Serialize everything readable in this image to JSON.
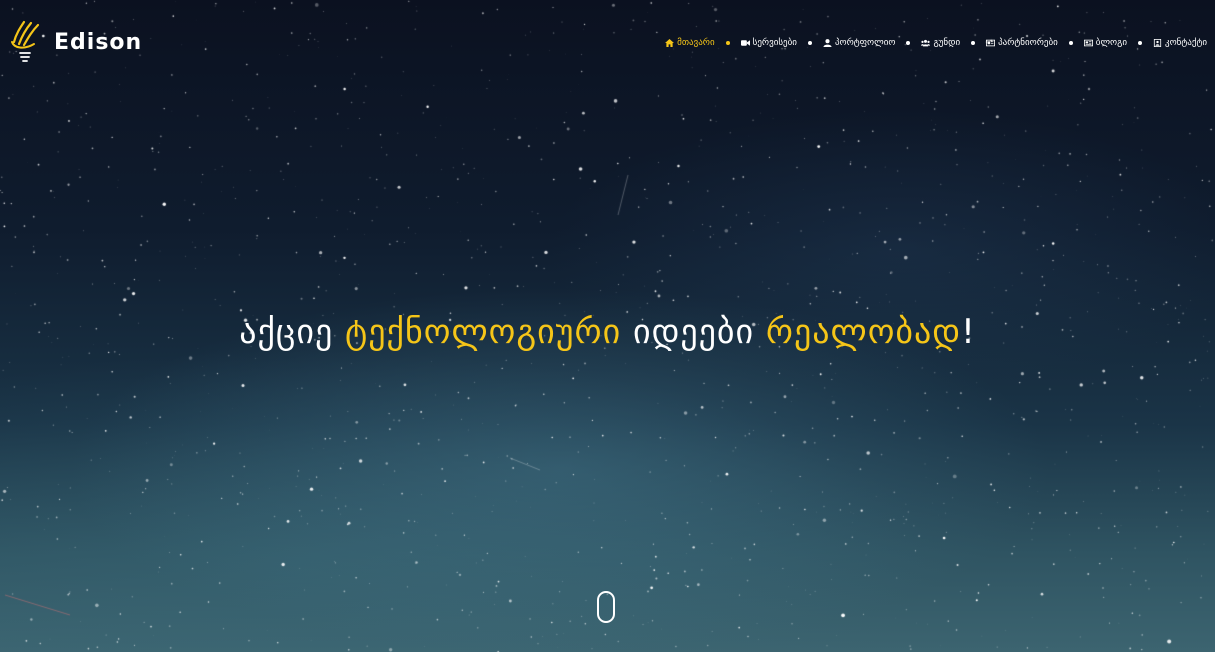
{
  "brand": {
    "name": "Edison",
    "accent_color": "#f5c518",
    "logo_icon": "lightbulb-slash-logo-icon"
  },
  "nav": {
    "items": [
      {
        "label": "მთავარი",
        "icon": "home-icon",
        "active": true
      },
      {
        "label": "სერვისები",
        "icon": "video-camera-icon",
        "active": false
      },
      {
        "label": "პორტფოლიო",
        "icon": "user-icon",
        "active": false
      },
      {
        "label": "გუნდი",
        "icon": "users-icon",
        "active": false
      },
      {
        "label": "პარტნიორები",
        "icon": "id-card-icon",
        "active": false
      },
      {
        "label": "ბლოგი",
        "icon": "newspaper-icon",
        "active": false
      },
      {
        "label": "კონტაქტი",
        "icon": "contact-card-icon",
        "active": false
      }
    ]
  },
  "hero": {
    "headline_part1": "აქციე ",
    "headline_part2": "ტექნოლოგიური",
    "headline_part3": " იდეები ",
    "headline_part4": "რეალობად",
    "headline_part5": "!",
    "scroll_icon": "scroll-mouse-icon"
  }
}
